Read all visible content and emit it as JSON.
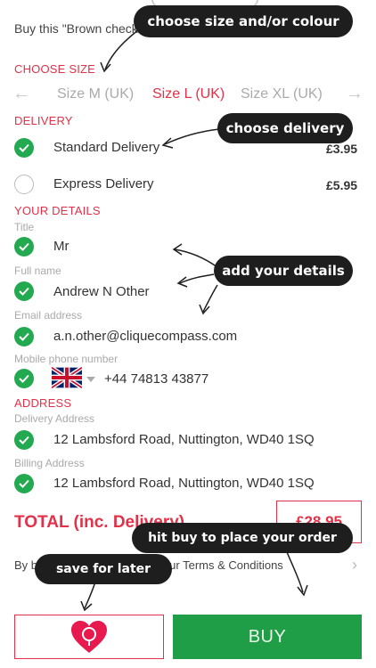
{
  "intro": "Buy this \"Brown check scarf ... \"",
  "sections": {
    "choose_size": "CHOOSE SIZE",
    "delivery": "DELIVERY",
    "your_details": "YOUR DETAILS",
    "address": "ADDRESS"
  },
  "sizes": {
    "options": [
      "Size M (UK)",
      "Size L (UK)",
      "Size XL (UK)"
    ],
    "selected": "Size L (UK)"
  },
  "delivery": [
    {
      "label": "Standard Delivery",
      "price": "£3.95",
      "selected": true
    },
    {
      "label": "Express Delivery",
      "price": "£5.95",
      "selected": false
    }
  ],
  "details": {
    "title_label": "Title",
    "title_value": "Mr",
    "name_label": "Full name",
    "name_value": "Andrew N Other",
    "email_label": "Email address",
    "email_value": "a.n.other@cliquecompass.com",
    "phone_label": "Mobile phone number",
    "phone_value": "+44 74813 43877",
    "phone_country_icon": "uk-flag-icon"
  },
  "address": {
    "delivery_label": "Delivery Address",
    "delivery_value": "12 Lambsford Road, Nuttington, WD40 1SQ",
    "billing_label": "Billing Address",
    "billing_value": "12 Lambsford Road, Nuttington, WD40 1SQ"
  },
  "total": {
    "label": "TOTAL (inc. Delivery)",
    "amount": "£28.95"
  },
  "terms": "By buying you are accepting our Terms & Conditions",
  "buttons": {
    "buy": "BUY",
    "save_icon": "heart-icon"
  },
  "annotations": {
    "size_colour": "choose size and/or colour",
    "delivery": "choose delivery",
    "details": "add your details",
    "buy": "hit buy to place your order",
    "save": "save for later"
  },
  "colors": {
    "accent_red": "#e23148",
    "green": "#23a94f",
    "buy_green": "#1f9d47",
    "bubble": "#1e1e1e"
  }
}
